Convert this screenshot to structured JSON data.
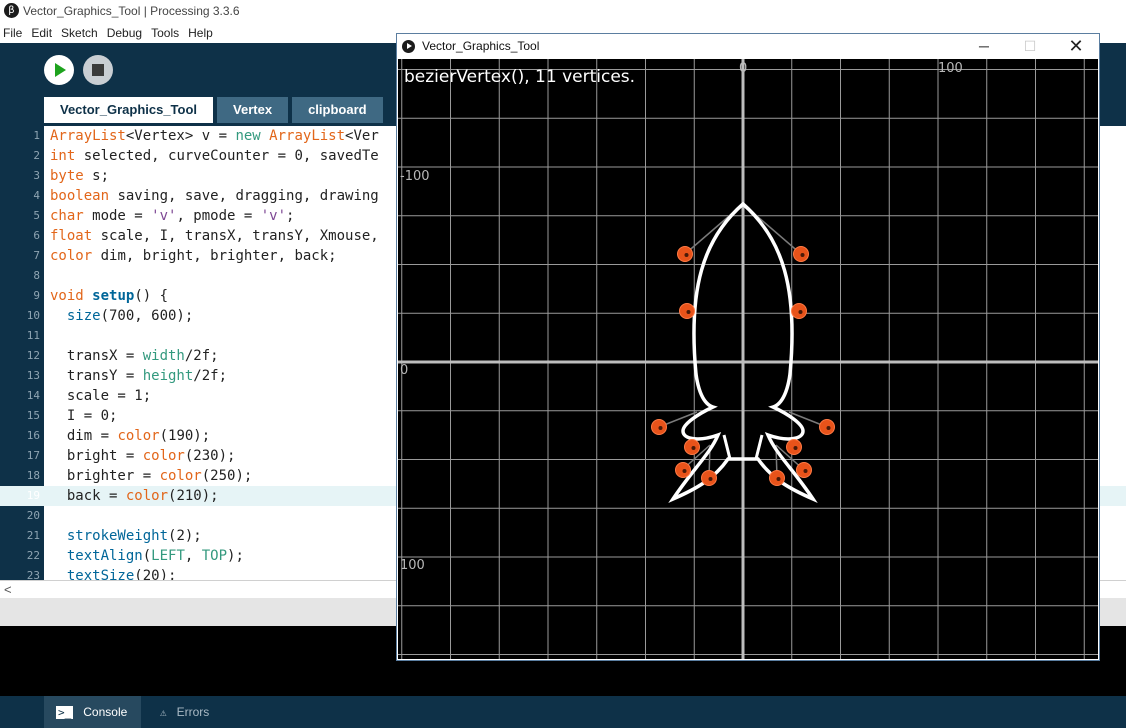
{
  "window": {
    "title": "Vector_Graphics_Tool | Processing 3.3.6",
    "app_icon": "processing-beta-icon"
  },
  "menu": [
    "File",
    "Edit",
    "Sketch",
    "Debug",
    "Tools",
    "Help"
  ],
  "toolbar": {
    "run_icon": "play-icon",
    "stop_icon": "stop-icon"
  },
  "tabs": [
    "Vector_Graphics_Tool",
    "Vertex",
    "clipboard"
  ],
  "active_tab": "Vector_Graphics_Tool",
  "code": {
    "highlighted_line": 19,
    "lines": [
      {
        "n": "1",
        "text": "ArrayList<Vertex> v = new ArrayList<Ver"
      },
      {
        "n": "2",
        "text": "int selected, curveCounter = 0, savedTe"
      },
      {
        "n": "3",
        "text": "byte s;"
      },
      {
        "n": "4",
        "text": "boolean saving, save, dragging, drawing"
      },
      {
        "n": "5",
        "text": "char mode = 'v', pmode = 'v';"
      },
      {
        "n": "6",
        "text": "float scale, I, transX, transY, Xmouse,"
      },
      {
        "n": "7",
        "text": "color dim, bright, brighter, back;"
      },
      {
        "n": "8",
        "text": ""
      },
      {
        "n": "9",
        "text": "void setup() {"
      },
      {
        "n": "10",
        "text": "  size(700, 600);"
      },
      {
        "n": "11",
        "text": ""
      },
      {
        "n": "12",
        "text": "  transX = width/2f;"
      },
      {
        "n": "13",
        "text": "  transY = height/2f;"
      },
      {
        "n": "14",
        "text": "  scale = 1;"
      },
      {
        "n": "15",
        "text": "  I = 0;"
      },
      {
        "n": "16",
        "text": "  dim = color(190);"
      },
      {
        "n": "17",
        "text": "  bright = color(230);"
      },
      {
        "n": "18",
        "text": "  brighter = color(250);"
      },
      {
        "n": "19",
        "text": "  back = color(210);"
      },
      {
        "n": "20",
        "text": ""
      },
      {
        "n": "21",
        "text": "  strokeWeight(2);"
      },
      {
        "n": "22",
        "text": "  textAlign(LEFT, TOP);"
      },
      {
        "n": "23",
        "text": "  textSize(20);"
      }
    ]
  },
  "console_tabs": [
    {
      "label": "Console",
      "icon": "console-icon"
    },
    {
      "label": "Errors",
      "icon": "warning-icon"
    }
  ],
  "sketch_window": {
    "title": "Vector_Graphics_Tool",
    "controls": {
      "minimize": "─",
      "maximize": "☐",
      "close": "✕"
    },
    "status": "bezierVertex(), 11 vertices.",
    "axis_labels": {
      "top_zero": "0",
      "top_hundred": "100",
      "left_neg_hundred": "-100",
      "left_zero": "0",
      "left_hundred": "100"
    },
    "colors": {
      "background": "#000000",
      "grid": "#9a9a9a",
      "axis": "#bdbdbd",
      "shape": "#ffffff",
      "handle": "#e8531a"
    }
  }
}
